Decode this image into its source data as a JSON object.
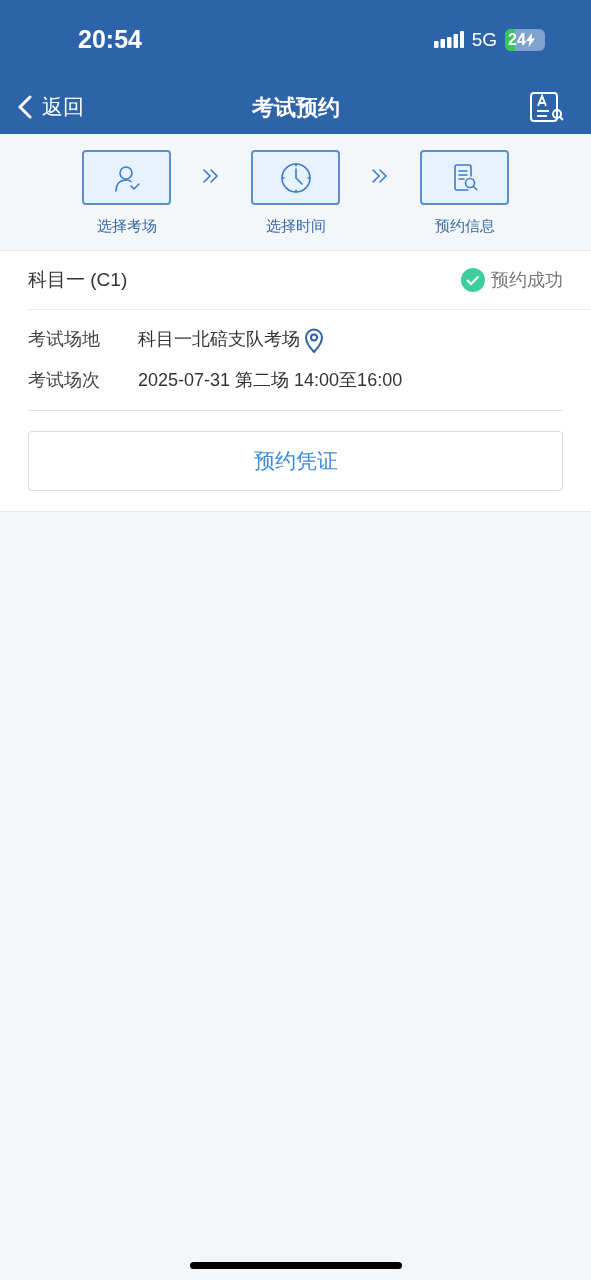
{
  "status_bar": {
    "time": "20:54",
    "network": "5G",
    "battery": "24"
  },
  "nav": {
    "back": "返回",
    "title": "考试预约"
  },
  "steps": [
    {
      "kind": "person",
      "label": "选择考场"
    },
    {
      "kind": "clock",
      "label": "选择时间"
    },
    {
      "kind": "document",
      "label": "预约信息"
    }
  ],
  "booking": {
    "subject": "科目一 (C1)",
    "status": "预约成功",
    "fields": [
      {
        "label": "考试场地",
        "value": "科目一北碚支队考场",
        "kind": "location"
      },
      {
        "label": "考试场次",
        "value": "2025-07-31 第二场 14:00至16:00",
        "kind": "plain"
      }
    ],
    "button": "预约凭证"
  }
}
